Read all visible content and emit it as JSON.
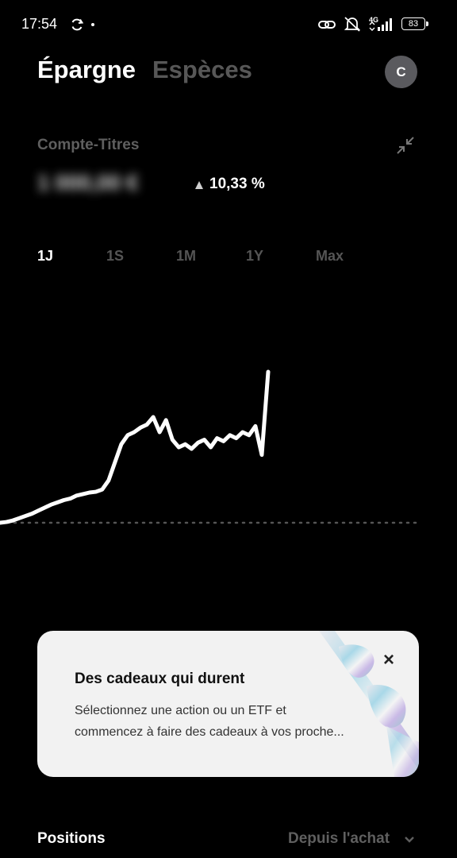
{
  "status_bar": {
    "time": "17:54",
    "network": "4G",
    "battery": "83"
  },
  "header": {
    "active_tab": "Épargne",
    "inactive_tab": "Espèces",
    "avatar_initial": "C"
  },
  "account": {
    "label": "Compte-Titres",
    "value_hidden": "1 000,00 €",
    "change": "10,33 %",
    "trend_icon": "up-triangle-icon"
  },
  "ranges": {
    "items": [
      "1J",
      "1S",
      "1M",
      "1Y",
      "Max"
    ],
    "selected": "1J"
  },
  "chart_data": {
    "type": "line",
    "series": [
      {
        "values": [
          0,
          0.5,
          1.5,
          3,
          4.5,
          6,
          8,
          10,
          12,
          13.5,
          15,
          16,
          18,
          19,
          20,
          20.5,
          22,
          28,
          40,
          52,
          58,
          60,
          63,
          65,
          70,
          60,
          68,
          55,
          50,
          52,
          49,
          53,
          55,
          50,
          56,
          54,
          58,
          56,
          60,
          58,
          64,
          45,
          100
        ]
      }
    ],
    "baseline": 0,
    "colors": {
      "line": "#ffffff",
      "baseline": "#555555"
    }
  },
  "promo": {
    "title": "Des cadeaux qui durent",
    "text": "Sélectionnez une action ou un ETF et commencez à faire des cadeaux à vos proche...",
    "close_label": "×"
  },
  "positions": {
    "title": "Positions",
    "sort_label": "Depuis l'achat"
  }
}
